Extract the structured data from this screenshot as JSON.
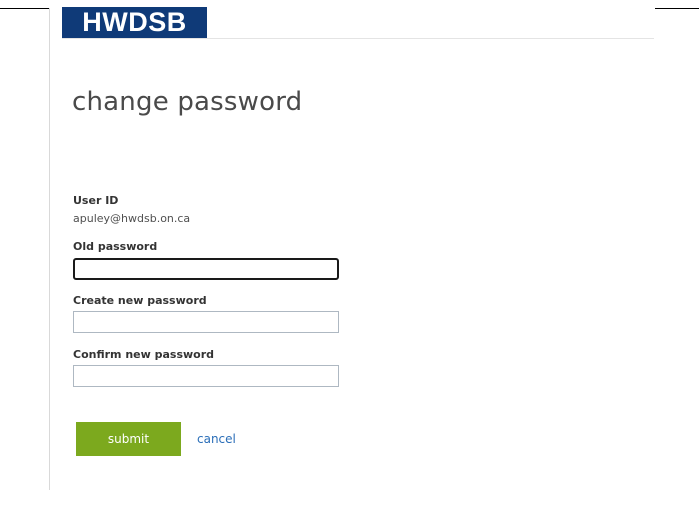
{
  "header": {
    "logo_text": "HWDSB"
  },
  "page": {
    "title": "change password"
  },
  "form": {
    "user_id_label": "User ID",
    "user_id_value": "apuley@hwdsb.on.ca",
    "old_password_label": "Old password",
    "old_password_value": "",
    "new_password_label": "Create new password",
    "new_password_value": "",
    "confirm_password_label": "Confirm new password",
    "confirm_password_value": "",
    "submit_label": "submit",
    "cancel_label": "cancel"
  },
  "colors": {
    "logo_background": "#0f3a78",
    "submit_background": "#7ca91e",
    "link": "#2a6eb8"
  }
}
